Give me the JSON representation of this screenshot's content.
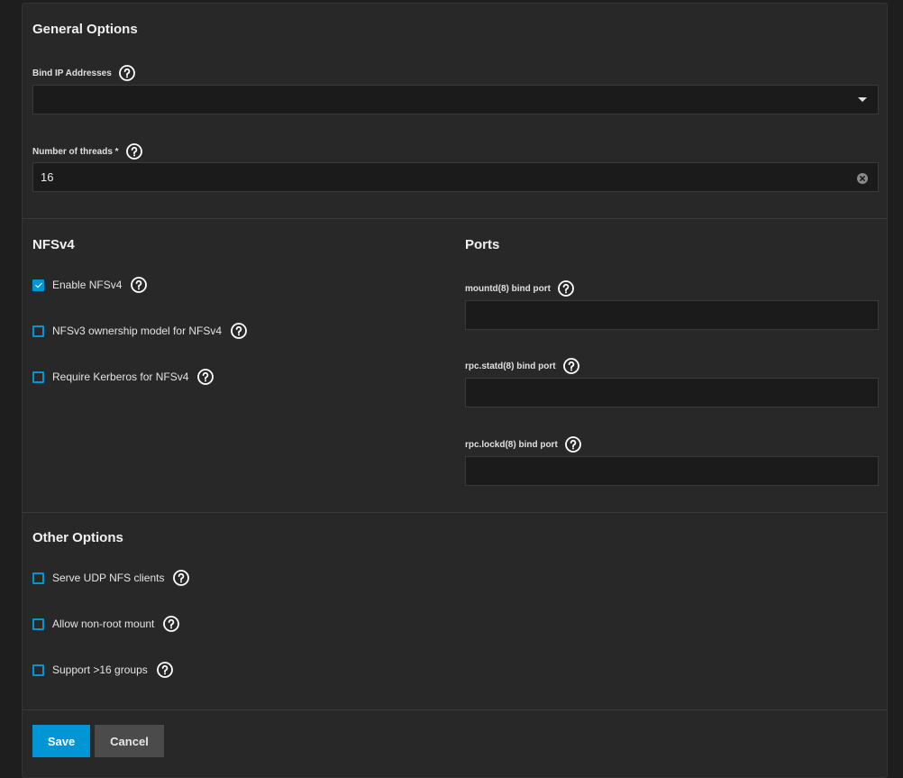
{
  "general": {
    "title": "General Options",
    "bind_ip": {
      "label": "Bind IP Addresses",
      "value": ""
    },
    "threads": {
      "label": "Number of threads *",
      "value": "16"
    }
  },
  "nfsv4": {
    "title": "NFSv4",
    "options": [
      {
        "label": "Enable NFSv4",
        "checked": true
      },
      {
        "label": "NFSv3 ownership model for NFSv4",
        "checked": false
      },
      {
        "label": "Require Kerberos for NFSv4",
        "checked": false
      }
    ]
  },
  "ports": {
    "title": "Ports",
    "fields": [
      {
        "label": "mountd(8) bind port",
        "value": ""
      },
      {
        "label": "rpc.statd(8) bind port",
        "value": ""
      },
      {
        "label": "rpc.lockd(8) bind port",
        "value": ""
      }
    ]
  },
  "other": {
    "title": "Other Options",
    "options": [
      {
        "label": "Serve UDP NFS clients",
        "checked": false
      },
      {
        "label": "Allow non-root mount",
        "checked": false
      },
      {
        "label": "Support >16 groups",
        "checked": false
      }
    ]
  },
  "actions": {
    "save": "Save",
    "cancel": "Cancel"
  },
  "colors": {
    "accent": "#0095d5",
    "background": "#282828",
    "input": "#1b1b1b"
  }
}
